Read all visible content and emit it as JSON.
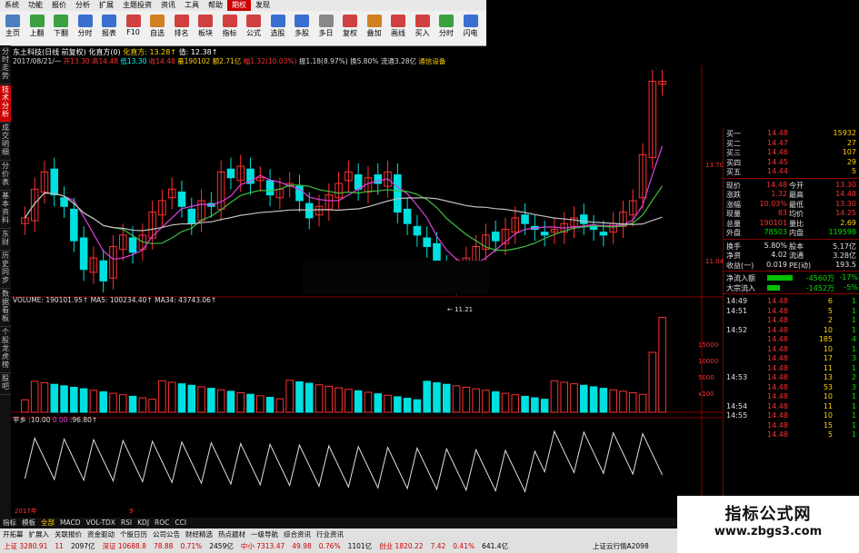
{
  "menubar": {
    "items": [
      "系统",
      "功能",
      "报价",
      "分析",
      "扩展",
      "主题投资",
      "资讯",
      "工具",
      "帮助",
      "期权",
      "发现"
    ],
    "active_index": 9,
    "right_items": [
      "交易未登录",
      "东土科"
    ]
  },
  "toolbar": {
    "buttons": [
      {
        "label": "主页",
        "icon": "home-icon",
        "color": "#4a7fc0"
      },
      {
        "label": "上翻",
        "icon": "page-up-icon",
        "color": "#3aa040"
      },
      {
        "label": "下翻",
        "icon": "page-down-icon",
        "color": "#3aa040"
      },
      {
        "label": "分时",
        "icon": "timeshare-icon",
        "color": "#3a6fd0"
      },
      {
        "label": "报表",
        "icon": "report-icon",
        "color": "#3a6fd0"
      },
      {
        "label": "F10",
        "icon": "f10-icon",
        "color": "#d04040"
      },
      {
        "label": "自选",
        "icon": "favorite-icon",
        "color": "#d08020"
      },
      {
        "label": "排名",
        "icon": "ranking-icon",
        "color": "#d04040"
      },
      {
        "label": "板块",
        "icon": "sector-icon",
        "color": "#d04040"
      },
      {
        "label": "指标",
        "icon": "indicator-icon",
        "color": "#d04040"
      },
      {
        "label": "公式",
        "icon": "formula-icon",
        "color": "#d04040"
      },
      {
        "label": "选股",
        "icon": "stock-picker-icon",
        "color": "#3a6fd0"
      },
      {
        "label": "多股",
        "icon": "multi-stock-icon",
        "color": "#3a6fd0"
      },
      {
        "label": "多日",
        "icon": "multi-day-icon",
        "color": "#888888"
      },
      {
        "label": "复权",
        "icon": "rights-icon",
        "color": "#d04040"
      },
      {
        "label": "叠加",
        "icon": "overlay-icon",
        "color": "#d08020"
      },
      {
        "label": "画线",
        "icon": "draw-line-icon",
        "color": "#d04040"
      },
      {
        "label": "买入",
        "icon": "buy-icon",
        "color": "#d04040"
      },
      {
        "label": "分时",
        "icon": "timeshare-icon",
        "color": "#3aa040"
      },
      {
        "label": "闪电",
        "icon": "lightning-icon",
        "color": "#3a6fd0"
      }
    ]
  },
  "left_tabs": [
    {
      "label": "分时走势",
      "active": false
    },
    {
      "label": "技术分析",
      "active": true
    },
    {
      "label": "成交明细",
      "active": false
    },
    {
      "label": "分价表",
      "active": false
    },
    {
      "label": "基本资料",
      "active": false
    },
    {
      "label": "东财",
      "active": false
    },
    {
      "label": "历史同步",
      "active": false
    },
    {
      "label": "数据看板",
      "active": false
    },
    {
      "label": "个股龙虎榜",
      "active": false
    },
    {
      "label": "股吧",
      "active": false
    }
  ],
  "chart_header": {
    "title": "东土科技(日线 前复权) 化直方(0)",
    "ma_label": "化直方: 13.28↑",
    "ma_value": "值: 12.38↑",
    "info_date": "2017/08/21/一",
    "info_open": "开13.30",
    "info_high": "高14.48",
    "info_low": "低13.30",
    "info_close": "收14.48",
    "info_volume": "量190102",
    "info_amount": "额2.71亿",
    "info_change": "幅1.32(10.03%)",
    "info_amp": "振1.18(8.97%)",
    "info_turnover": "换5.80%",
    "info_float": "流通3.28亿",
    "info_sector": "通信设备"
  },
  "volume_header": {
    "vol": "VOLUME: 190101.95↑",
    "ma5": "MA5: 100234.40↑",
    "ma34": "MA34: 43743.06↑"
  },
  "osc_header": {
    "name": "平乡",
    "v1": ":10.00",
    "v2": "0.00",
    "v3": ":96.80↑"
  },
  "price_axis": [
    "13.70",
    "11.04"
  ],
  "low_marker": "← 11.21",
  "vol_axis": [
    "15000",
    "10000",
    "5000",
    "x100"
  ],
  "date_axis": [
    "2017年",
    "9"
  ],
  "colors": {
    "up": "#ff3030",
    "down": "#00e0e0",
    "ma_short": "#e040e0",
    "ma_mid": "#40c040",
    "ma_long": "#c0c0c0"
  },
  "quote": {
    "bids": [
      {
        "label": "买一",
        "price": "14.48",
        "vol": "15932"
      },
      {
        "label": "买二",
        "price": "14.47",
        "vol": "27"
      },
      {
        "label": "买三",
        "price": "14.46",
        "vol": "107"
      },
      {
        "label": "买四",
        "price": "14.45",
        "vol": "29"
      },
      {
        "label": "买五",
        "price": "14.44",
        "vol": "5"
      }
    ],
    "stats": [
      {
        "l1": "现价",
        "v1": "14.48",
        "l2": "今开",
        "v2": "13.30"
      },
      {
        "l1": "涨跌",
        "v1": "1.32",
        "l2": "最高",
        "v2": "14.48"
      },
      {
        "l1": "涨幅",
        "v1": "10.03%",
        "l2": "最低",
        "v2": "13.30"
      },
      {
        "l1": "现量",
        "v1": "83",
        "l2": "均价",
        "v2": "14.25"
      },
      {
        "l1": "总量",
        "v1": "190101",
        "l2": "量比",
        "v2": "2.69"
      },
      {
        "l1": "外盘",
        "v1": "78503",
        "l2": "内盘",
        "v2": "119598"
      }
    ],
    "stats2": [
      {
        "l1": "换手",
        "v1": "5.80%",
        "l2": "股本",
        "v2": "5.17亿"
      },
      {
        "l1": "净资",
        "v1": "4.02",
        "l2": "流通",
        "v2": "3.28亿"
      },
      {
        "l1": "收益(一)",
        "v1": "0.019",
        "l2": "PE(动)",
        "v2": "193.5"
      }
    ],
    "flows": [
      {
        "label": "净流入额",
        "value": "-4560万",
        "pct": "-17%"
      },
      {
        "label": "大宗流入",
        "value": "-1452万",
        "pct": "-5%"
      }
    ],
    "ticks": [
      {
        "time": "14:49",
        "price": "14.48",
        "vol": "6",
        "n": "1"
      },
      {
        "time": "14:51",
        "price": "14.48",
        "vol": "5",
        "n": "1"
      },
      {
        "time": "",
        "price": "14.48",
        "vol": "2",
        "n": "1"
      },
      {
        "time": "14:52",
        "price": "14.48",
        "vol": "10",
        "n": "1"
      },
      {
        "time": "",
        "price": "14.48",
        "vol": "185",
        "n": "4"
      },
      {
        "time": "",
        "price": "14.48",
        "vol": "10",
        "n": "1"
      },
      {
        "time": "",
        "price": "14.48",
        "vol": "17",
        "n": "3"
      },
      {
        "time": "",
        "price": "14.48",
        "vol": "11",
        "n": "1"
      },
      {
        "time": "14:53",
        "price": "14.48",
        "vol": "13",
        "n": "2"
      },
      {
        "time": "",
        "price": "14.48",
        "vol": "53",
        "n": "3"
      },
      {
        "time": "",
        "price": "14.48",
        "vol": "10",
        "n": "1"
      },
      {
        "time": "14:54",
        "price": "14.48",
        "vol": "11",
        "n": "1"
      },
      {
        "time": "14:55",
        "price": "14.48",
        "vol": "10",
        "n": "1"
      },
      {
        "time": "",
        "price": "14.48",
        "vol": "15",
        "n": "1"
      },
      {
        "time": "",
        "price": "14.48",
        "vol": "5",
        "n": "1"
      }
    ]
  },
  "bottom_tabs": [
    "指标",
    "模板",
    "全部",
    "MACD",
    "VOL-TDX",
    "RSI",
    "KDJ",
    "ROC",
    "CCI"
  ],
  "bottom_tabs2": [
    "开拓幕",
    "扩展入",
    "关联报价",
    "资金驱动",
    "个股日历",
    "公司公告",
    "财经精选",
    "热点题材",
    "一级导航",
    "综合资讯",
    "行业资讯"
  ],
  "status": {
    "sh": "上证 3280.91",
    "sh_chg": "11",
    "sh_amt": "2097亿",
    "sz": "深证 10688.8",
    "sz_chg": "78.88",
    "sz_pct": "0.71%",
    "sz_amt": "2459亿",
    "zx": "中小 7313.47",
    "zx_chg": "49.98",
    "zx_pct": "0.76%",
    "zx_amt": "1101亿",
    "cy": "创业 1820.22",
    "cy_chg": "7.42",
    "cy_pct": "0.41%",
    "cy_amt": "641.4亿",
    "right": "上证云行情A2098"
  },
  "watermark": {
    "line1": "指标公式网",
    "line2": "www.zbgs3.com"
  }
}
